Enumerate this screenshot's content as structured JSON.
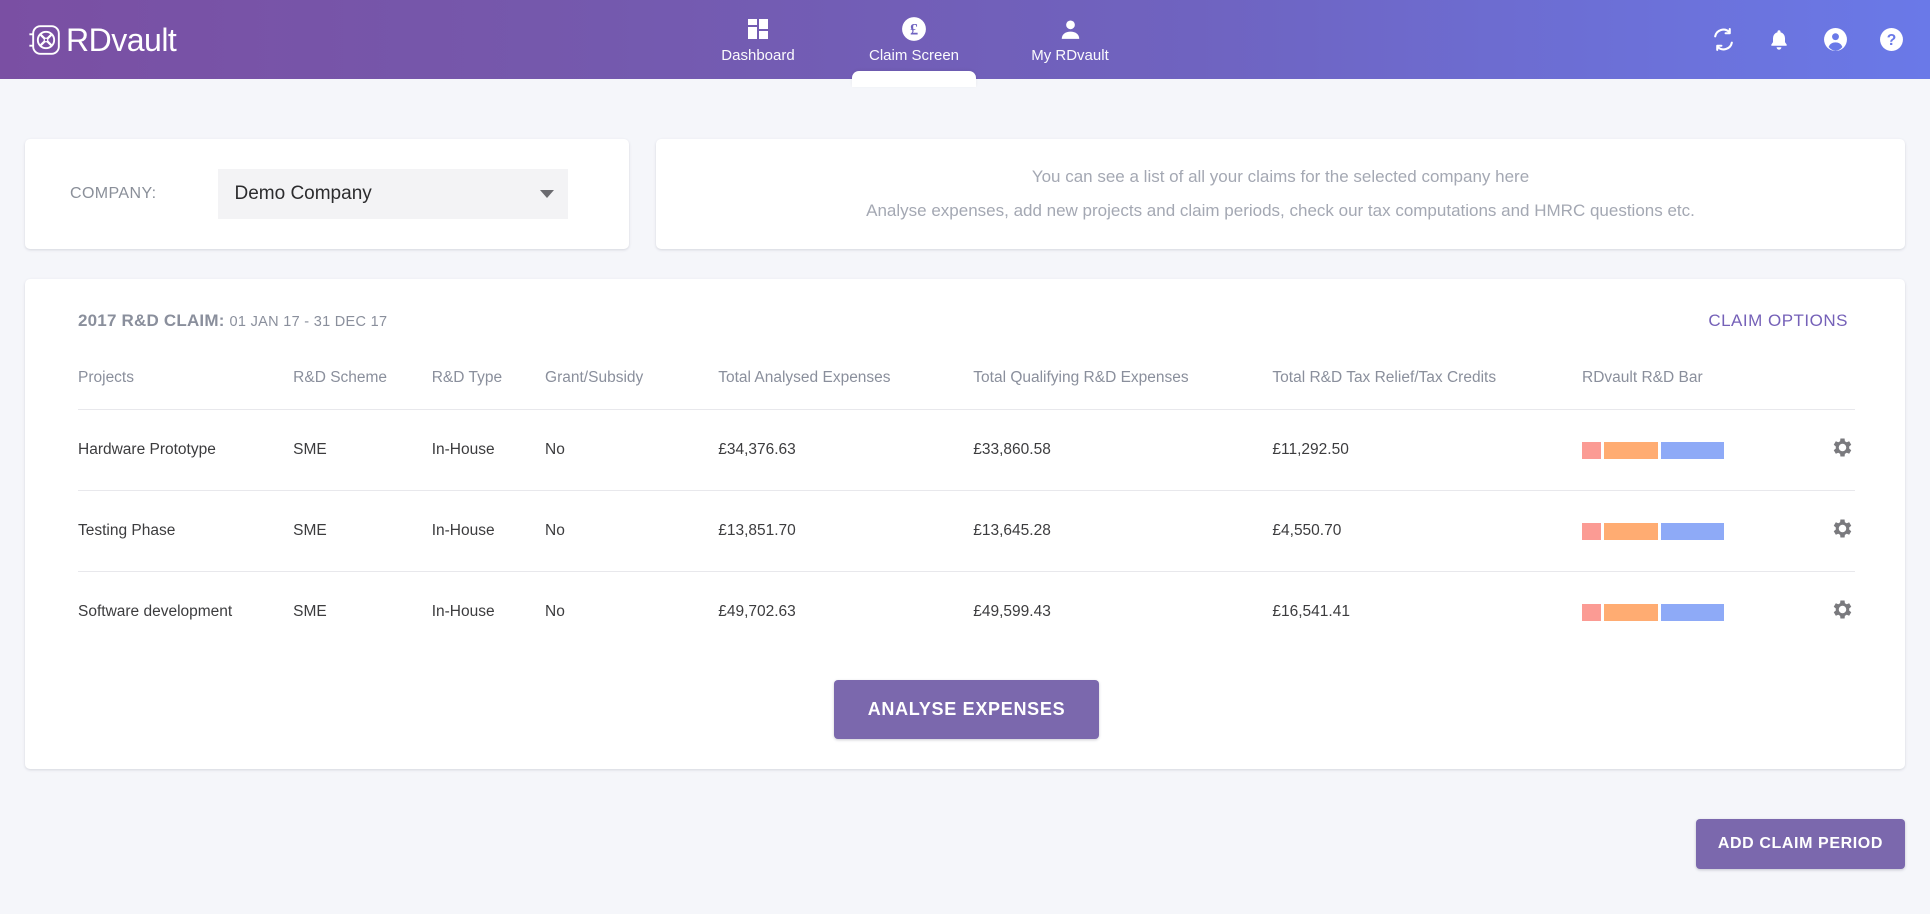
{
  "brand": {
    "name": "RDvault",
    "icon": "vault-icon"
  },
  "nav": {
    "tabs": [
      {
        "label": "Dashboard",
        "icon": "dashboard-grid-icon",
        "active": false
      },
      {
        "label": "Claim Screen",
        "icon": "pound-circle-icon",
        "active": true
      },
      {
        "label": "My RDvault",
        "icon": "person-icon",
        "active": false
      }
    ],
    "actions": [
      {
        "icon": "sync-icon",
        "label": "Sync"
      },
      {
        "icon": "bell-icon",
        "label": "Notifications"
      },
      {
        "icon": "account-circle-icon",
        "label": "Account"
      },
      {
        "icon": "help-circle-icon",
        "label": "Help"
      }
    ]
  },
  "company": {
    "label": "COMPANY:",
    "selected": "Demo Company",
    "caret_icon": "chevron-down-icon"
  },
  "info": {
    "line1": "You can see a list of all your claims for the selected company here",
    "line2": "Analyse expenses, add new projects and claim periods, check our tax computations and HMRC questions etc."
  },
  "claim": {
    "title": "2017 R&D CLAIM:",
    "dates": "01 JAN 17 - 31 DEC 17",
    "options_label": "CLAIM OPTIONS"
  },
  "table": {
    "columns": [
      "Projects",
      "R&D Scheme",
      "R&D Type",
      "Grant/Subsidy",
      "Total Analysed Expenses",
      "Total Qualifying R&D Expenses",
      "Total R&D Tax Relief/Tax Credits",
      "RDvault R&D Bar"
    ],
    "rows": [
      {
        "project": "Hardware Prototype",
        "scheme": "SME",
        "type": "In-House",
        "grant": "No",
        "analysed": "£34,376.63",
        "qualifying": "£33,860.58",
        "relief": "£11,292.50",
        "gear_icon": "gear-icon"
      },
      {
        "project": "Testing Phase",
        "scheme": "SME",
        "type": "In-House",
        "grant": "No",
        "analysed": "£13,851.70",
        "qualifying": "£13,645.28",
        "relief": "£4,550.70",
        "gear_icon": "gear-icon"
      },
      {
        "project": "Software development",
        "scheme": "SME",
        "type": "In-House",
        "grant": "No",
        "analysed": "£49,702.63",
        "qualifying": "£49,599.43",
        "relief": "£16,541.41",
        "gear_icon": "gear-icon"
      }
    ]
  },
  "buttons": {
    "analyse": "ANALYSE EXPENSES",
    "add_claim_period": "ADD CLAIM PERIOD"
  },
  "colors": {
    "brand_purple": "#7b68ad",
    "header_left": "#7a4fa3",
    "header_right": "#6a79e8",
    "amount_blue": "#8fa9f5",
    "amount_orange": "#f9a06b",
    "amount_pink": "#fba9a0",
    "bar_pink": "#fb9b94",
    "bar_orange": "#ffac72",
    "bar_blue": "#8eaaf7"
  }
}
